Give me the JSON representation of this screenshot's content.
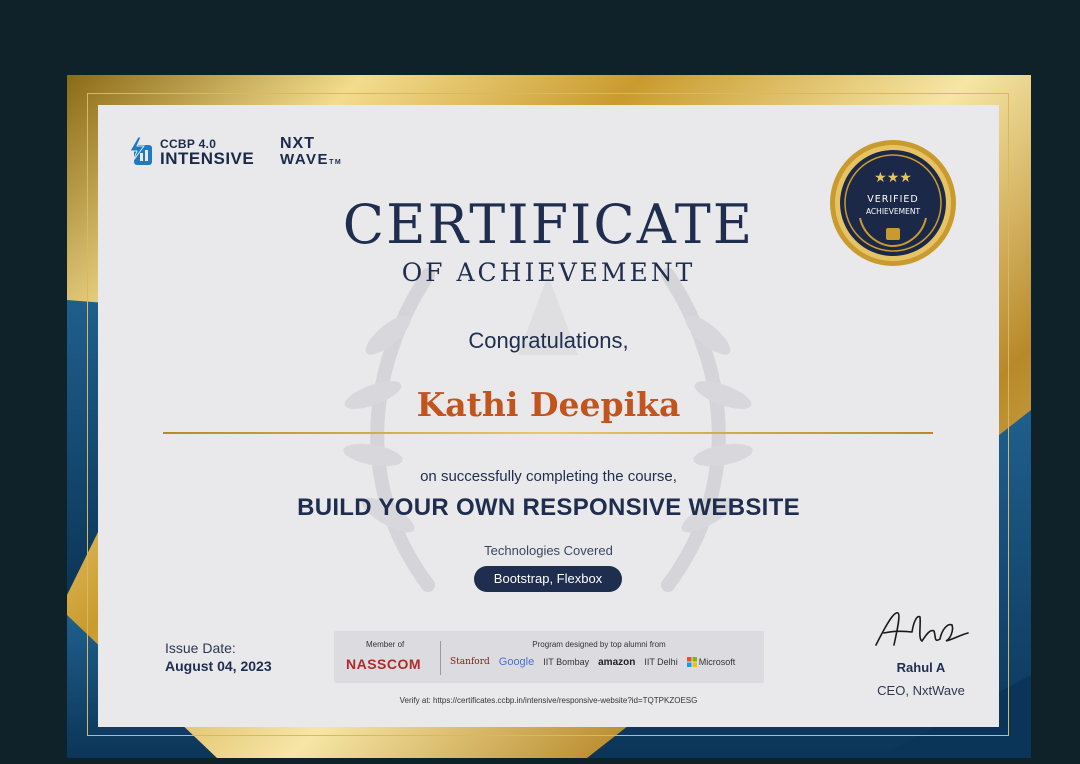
{
  "colors": {
    "navy": "#1f2d4e",
    "gold": "#c99b2e",
    "recipient": "#c2541d",
    "paper": "#e9e9ec",
    "background": "#0f2229"
  },
  "logos": {
    "ccbp_line1": "CCBP 4.0",
    "ccbp_line2": "INTENSIVE",
    "nxtwave_line1": "NXT",
    "nxtwave_line2": "WAVE",
    "nxtwave_tm": "TM"
  },
  "badge": {
    "line1": "VERIFIED",
    "line2": "ACHIEVEMENT",
    "stars": "★★★"
  },
  "certificate": {
    "title": "CERTIFICATE",
    "subtitle": "OF ACHIEVEMENT",
    "congrats": "Congratulations,",
    "recipient": "Kathi Deepika",
    "completing_text": "on successfully completing the course,",
    "course": "BUILD YOUR OWN RESPONSIVE WEBSITE",
    "tech_label": "Technologies Covered",
    "technologies": "Bootstrap, Flexbox"
  },
  "issue": {
    "label": "Issue Date:",
    "date": "August 04, 2023"
  },
  "partners": {
    "member_of": "Member of",
    "nasscom": "NASSCOM",
    "designed_by": "Program designed by top alumni from",
    "stanford": "Stanford",
    "google": "Google",
    "iit_bombay": "IIT Bombay",
    "amazon": "amazon",
    "iit_delhi": "IIT Delhi",
    "microsoft": "Microsoft"
  },
  "verify": {
    "text": "Verify at: https://certificates.ccbp.in/intensive/responsive-website?id=TQTPKZOESG"
  },
  "signature": {
    "name": "Rahul A",
    "title": "CEO, NxtWave"
  }
}
